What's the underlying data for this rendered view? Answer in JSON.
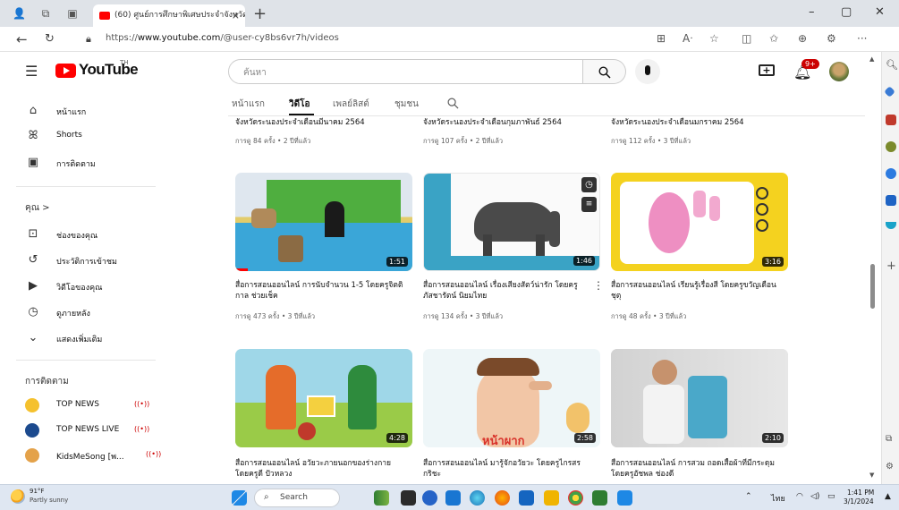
{
  "browser": {
    "tab_title": "(60) ศูนย์การศึกษาพิเศษประจำจังหวัด",
    "tab_close": "×",
    "new_tab": "+",
    "url_prefix": "https://",
    "url_host": "www.youtube.com",
    "url_path": "/@user-cy8bs6vr7h/videos",
    "window_controls": [
      "–",
      "▢",
      "✕"
    ]
  },
  "youtube": {
    "logo_text": "YouTube",
    "logo_suffix": "TH",
    "search_placeholder": "ค้นหา",
    "notification_count": "9+"
  },
  "guide": {
    "main": [
      {
        "label": "หน้าแรก",
        "icon": "home-icon"
      },
      {
        "label": "Shorts",
        "icon": "shorts-icon"
      },
      {
        "label": "การติดตาม",
        "icon": "subscriptions-icon"
      }
    ],
    "you_header": "คุณ >",
    "you": [
      {
        "label": "ช่องของคุณ",
        "icon": "channel-icon"
      },
      {
        "label": "ประวัติการเข้าชม",
        "icon": "history-icon"
      },
      {
        "label": "วิดีโอของคุณ",
        "icon": "your-videos-icon"
      },
      {
        "label": "ดูภายหลัง",
        "icon": "watch-later-icon"
      },
      {
        "label": "แสดงเพิ่มเติม",
        "icon": "chevron-down-icon"
      }
    ],
    "subs_header": "การติดตาม",
    "subscriptions": [
      {
        "label": "TOP NEWS",
        "color": "#f5c12e",
        "live": "((•))"
      },
      {
        "label": "TOP NEWS LIVE",
        "color": "#1c4a8e",
        "live": "((•))"
      },
      {
        "label": "KidsMeSong [พ...",
        "color": "#e4a24a",
        "live": "((•))"
      }
    ]
  },
  "channel_tabs": [
    "หน้าแรก",
    "วิดีโอ",
    "เพลย์ลิสต์",
    "ชุมชน"
  ],
  "top_row": [
    {
      "title": "จังหวัดระนองประจำเดือนมีนาคม 2564",
      "meta": "การดู 84 ครั้ง • 2 ปีที่แล้ว"
    },
    {
      "title": "จังหวัดระนองประจำเดือนกุมภาพันธ์ 2564",
      "meta": "การดู 107 ครั้ง • 2 ปีที่แล้ว"
    },
    {
      "title": "จังหวัดระนองประจำเดือนมกราคม 2564",
      "meta": "การดู 112 ครั้ง • 3 ปีที่แล้ว"
    }
  ],
  "videos": [
    {
      "title": "สื่อการสอนออนไลน์ การนับจำนวน 1-5 โดยครูจิตติกาล ช่วยเช็ค",
      "meta": "การดู 473 ครั้ง • 3 ปีที่แล้ว",
      "duration": "1:51"
    },
    {
      "title": "สื่อการสอนออนไลน์ เรื่องเสียงสัตว์น่ารัก โดยครูภัสชารัตน์ นิยมไทย",
      "meta": "การดู 134 ครั้ง • 3 ปีที่แล้ว",
      "duration": "1:46"
    },
    {
      "title": "สื่อการสอนออนไลน์ เรียนรู้เรื่องสี โดยครูขวัญเดือน ชุตุ",
      "meta": "การดู 48 ครั้ง • 3 ปีที่แล้ว",
      "duration": "3:16"
    },
    {
      "title": "สื่อการสอนออนไลน์ อวัยวะภายนอกของร่างกาย โดยครูดี ปัวหลวง",
      "meta": "",
      "duration": "4:28"
    },
    {
      "title": "สื่อการสอนออนไลน์ มารู้จักอวัยวะ โดยครูไกรสร กริชะ",
      "meta": "",
      "duration": "2:58",
      "overlay_text": "หน้าผาก"
    },
    {
      "title": "สื่อการสอนออนไลน์ การสวม ถอดเสื้อผ้าที่มีกระดุม โดยครูอัชพล ช่องดี",
      "meta": "",
      "duration": "2:10"
    }
  ],
  "taskbar": {
    "weather_temp": "91°F",
    "weather_desc": "Partly sunny",
    "search_label": "Search",
    "lang": "ไทย",
    "time": "1:41 PM",
    "date": "3/1/2024"
  }
}
